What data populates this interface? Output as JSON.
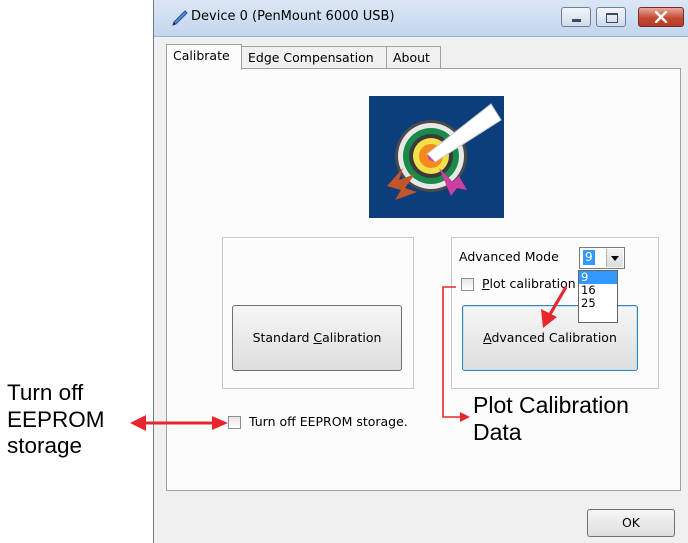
{
  "window": {
    "title": "Device 0 (PenMount 6000 USB)"
  },
  "tabs": [
    {
      "label": "Calibrate",
      "active": true
    },
    {
      "label": "Edge Compensation",
      "active": false
    },
    {
      "label": "About",
      "active": false
    }
  ],
  "calibrate": {
    "standard_button": {
      "pre": "Standard ",
      "mnemonic": "C",
      "post": "alibration"
    },
    "advanced_mode_label": "Advanced Mode",
    "advanced_mode_value": "9",
    "advanced_mode_options": [
      "9",
      "16",
      "25"
    ],
    "plot_calibration": {
      "pre": "",
      "mnemonic": "P",
      "post": "lot calibration",
      "checked": false
    },
    "advanced_button": {
      "pre": "",
      "mnemonic": "A",
      "post": "dvanced Calibration"
    },
    "eeprom_label": "Turn off EEPROM storage.",
    "eeprom_checked": false
  },
  "footer": {
    "ok_label": "OK"
  },
  "annotations": {
    "left_lines": [
      "Turn off",
      "EEPROM",
      "storage"
    ],
    "right_lines": [
      "Plot Calibration",
      "Data"
    ]
  },
  "colors": {
    "arrow": "#e8262d",
    "selection": "#3399ff",
    "logo_background": "#0b3e7a"
  },
  "icons": [
    "pen-icon",
    "minimize-icon",
    "maximize-icon",
    "close-icon",
    "calibration-target-icon",
    "combo-arrow-icon"
  ]
}
